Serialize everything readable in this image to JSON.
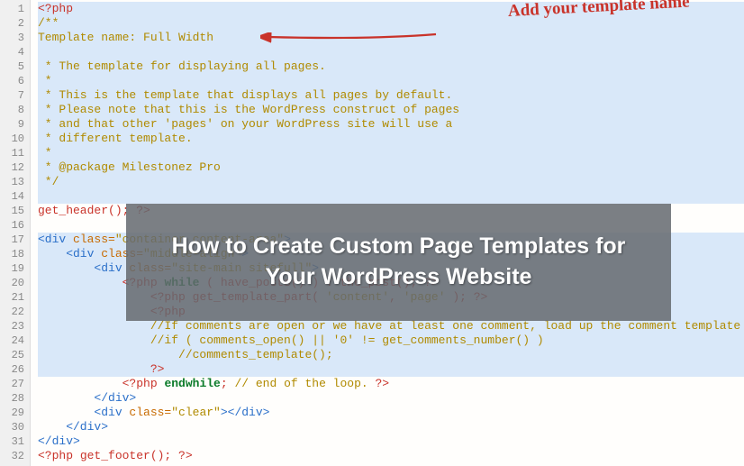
{
  "annotation_text": "Add your template name",
  "overlay_title": "How to Create Custom Page Templates for Your WordPress Website",
  "lines": [
    {
      "n": 1,
      "hl": true,
      "segs": [
        [
          "php",
          "<?php"
        ]
      ]
    },
    {
      "n": 2,
      "hl": true,
      "segs": [
        [
          "cmt",
          "/**"
        ]
      ]
    },
    {
      "n": 3,
      "hl": true,
      "segs": [
        [
          "cmt",
          "Template name: Full Width"
        ]
      ]
    },
    {
      "n": 4,
      "hl": true,
      "segs": [
        [
          "",
          ""
        ]
      ]
    },
    {
      "n": 5,
      "hl": true,
      "segs": [
        [
          "cmt",
          " * The template for displaying all pages."
        ]
      ]
    },
    {
      "n": 6,
      "hl": true,
      "segs": [
        [
          "cmt",
          " *"
        ]
      ]
    },
    {
      "n": 7,
      "hl": true,
      "segs": [
        [
          "cmt",
          " * This is the template that displays all pages by default."
        ]
      ]
    },
    {
      "n": 8,
      "hl": true,
      "segs": [
        [
          "cmt",
          " * Please note that this is the WordPress construct of pages"
        ]
      ]
    },
    {
      "n": 9,
      "hl": true,
      "segs": [
        [
          "cmt",
          " * and that other 'pages' on your WordPress site will use a"
        ]
      ]
    },
    {
      "n": 10,
      "hl": true,
      "segs": [
        [
          "cmt",
          " * different template."
        ]
      ]
    },
    {
      "n": 11,
      "hl": true,
      "segs": [
        [
          "cmt",
          " *"
        ]
      ]
    },
    {
      "n": 12,
      "hl": true,
      "segs": [
        [
          "cmt",
          " * @package Milestonez Pro"
        ]
      ]
    },
    {
      "n": 13,
      "hl": true,
      "segs": [
        [
          "cmt",
          " */"
        ]
      ]
    },
    {
      "n": 14,
      "hl": true,
      "segs": [
        [
          "",
          ""
        ]
      ]
    },
    {
      "n": 15,
      "hl": false,
      "segs": [
        [
          "txt",
          "get_header(); "
        ],
        [
          "php",
          "?>"
        ]
      ]
    },
    {
      "n": 16,
      "hl": false,
      "segs": [
        [
          "",
          ""
        ]
      ]
    },
    {
      "n": 17,
      "hl": true,
      "segs": [
        [
          "tag",
          "<div "
        ],
        [
          "attr",
          "class="
        ],
        [
          "str",
          "\"container content-area\""
        ],
        [
          "tag",
          ">"
        ]
      ]
    },
    {
      "n": 18,
      "hl": true,
      "segs": [
        [
          "tag",
          "    <div "
        ],
        [
          "attr",
          "class="
        ],
        [
          "str",
          "\"middle-align\""
        ],
        [
          "tag",
          ">"
        ]
      ]
    },
    {
      "n": 19,
      "hl": true,
      "segs": [
        [
          "tag",
          "        <div "
        ],
        [
          "attr",
          "class="
        ],
        [
          "str",
          "\"site-main sitefull\""
        ],
        [
          "tag",
          ">"
        ]
      ]
    },
    {
      "n": 20,
      "hl": true,
      "segs": [
        [
          "",
          "            "
        ],
        [
          "php",
          "<?php "
        ],
        [
          "key",
          "while"
        ],
        [
          "txt",
          " ( have_posts() ) : the_post(); "
        ],
        [
          "php",
          "?>"
        ]
      ]
    },
    {
      "n": 21,
      "hl": true,
      "segs": [
        [
          "",
          "                "
        ],
        [
          "php",
          "<?php"
        ],
        [
          "txt",
          " get_template_part( "
        ],
        [
          "str",
          "'content'"
        ],
        [
          "txt",
          ", "
        ],
        [
          "str",
          "'page'"
        ],
        [
          "txt",
          " ); "
        ],
        [
          "php",
          "?>"
        ]
      ]
    },
    {
      "n": 22,
      "hl": true,
      "segs": [
        [
          "",
          "                "
        ],
        [
          "php",
          "<?php"
        ]
      ]
    },
    {
      "n": 23,
      "hl": true,
      "segs": [
        [
          "",
          "                "
        ],
        [
          "cmt",
          "//If comments are open or we have at least one comment, load up the comment template"
        ]
      ]
    },
    {
      "n": 24,
      "hl": true,
      "segs": [
        [
          "",
          "                "
        ],
        [
          "cmt",
          "//if ( comments_open() || '0' != get_comments_number() )"
        ]
      ]
    },
    {
      "n": 25,
      "hl": true,
      "segs": [
        [
          "",
          "                    "
        ],
        [
          "cmt",
          "//comments_template();"
        ]
      ]
    },
    {
      "n": 26,
      "hl": true,
      "segs": [
        [
          "",
          "                "
        ],
        [
          "php",
          "?>"
        ]
      ]
    },
    {
      "n": 27,
      "hl": false,
      "segs": [
        [
          "",
          "            "
        ],
        [
          "php",
          "<?php "
        ],
        [
          "key",
          "endwhile"
        ],
        [
          "txt",
          "; "
        ],
        [
          "cmt",
          "// end of the loop. "
        ],
        [
          "php",
          "?>"
        ]
      ]
    },
    {
      "n": 28,
      "hl": false,
      "segs": [
        [
          "tag",
          "        </div>"
        ]
      ]
    },
    {
      "n": 29,
      "hl": false,
      "segs": [
        [
          "tag",
          "        <div "
        ],
        [
          "attr",
          "class="
        ],
        [
          "str",
          "\"clear\""
        ],
        [
          "tag",
          "></div>"
        ]
      ]
    },
    {
      "n": 30,
      "hl": false,
      "segs": [
        [
          "tag",
          "    </div>"
        ]
      ]
    },
    {
      "n": 31,
      "hl": false,
      "segs": [
        [
          "tag",
          "</div>"
        ]
      ]
    },
    {
      "n": 32,
      "hl": false,
      "segs": [
        [
          "php",
          "<?php"
        ],
        [
          "txt",
          " get_footer(); "
        ],
        [
          "php",
          "?>"
        ]
      ]
    }
  ]
}
